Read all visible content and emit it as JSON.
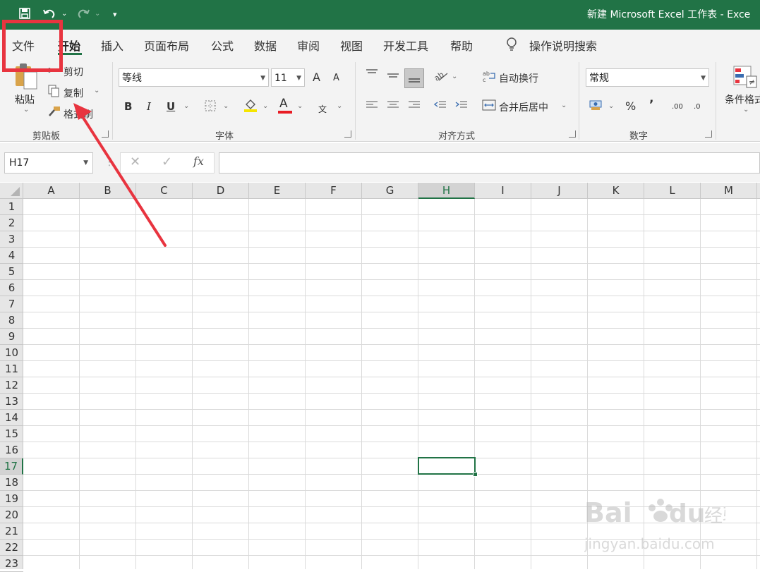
{
  "window": {
    "title": "新建 Microsoft Excel 工作表 - Exce"
  },
  "quick_access": {
    "save_icon": "save-icon",
    "undo_icon": "undo-icon",
    "redo_icon": "redo-icon"
  },
  "tabs": [
    {
      "label": "文件"
    },
    {
      "label": "开始"
    },
    {
      "label": "插入"
    },
    {
      "label": "页面布局"
    },
    {
      "label": "公式"
    },
    {
      "label": "数据"
    },
    {
      "label": "审阅"
    },
    {
      "label": "视图"
    },
    {
      "label": "开发工具"
    },
    {
      "label": "帮助"
    }
  ],
  "search": {
    "label": "操作说明搜索"
  },
  "ribbon": {
    "clipboard": {
      "paste": "粘贴",
      "cut": "剪切",
      "copy": "复制",
      "format_painter": "格式刷",
      "group": "剪贴板"
    },
    "font": {
      "font_name": "等线",
      "font_size": "11",
      "group": "字体",
      "bold": "B",
      "italic": "I",
      "underline": "U",
      "font_color_letter": "A",
      "wen_letter": "文",
      "grow": "A",
      "shrink": "A"
    },
    "alignment": {
      "wrap": "自动换行",
      "merge": "合并后居中",
      "group": "对齐方式"
    },
    "number": {
      "format": "常规",
      "percent": "%",
      "comma": "’",
      "inc_decimal": ".00",
      "dec_decimal": ".0",
      "group": "数字"
    },
    "styles": {
      "conditional": "条件格式"
    }
  },
  "formula_bar": {
    "name_box": "H17",
    "fx": "fx",
    "value": ""
  },
  "columns": [
    "A",
    "B",
    "C",
    "D",
    "E",
    "F",
    "G",
    "H",
    "I",
    "J",
    "K",
    "L",
    "M"
  ],
  "rows": [
    "1",
    "2",
    "3",
    "4",
    "5",
    "6",
    "7",
    "8",
    "9",
    "10",
    "11",
    "12",
    "13",
    "14",
    "15",
    "16",
    "17",
    "18",
    "19",
    "20",
    "21",
    "22",
    "23"
  ],
  "selection": {
    "column": "H",
    "row": "17"
  },
  "watermark": {
    "text": "Baidu经验",
    "url": "jingyan.baidu.com"
  },
  "annotation_colors": {
    "highlight": "#e8343f",
    "arrow": "#e8343f",
    "accent": "#217346"
  }
}
